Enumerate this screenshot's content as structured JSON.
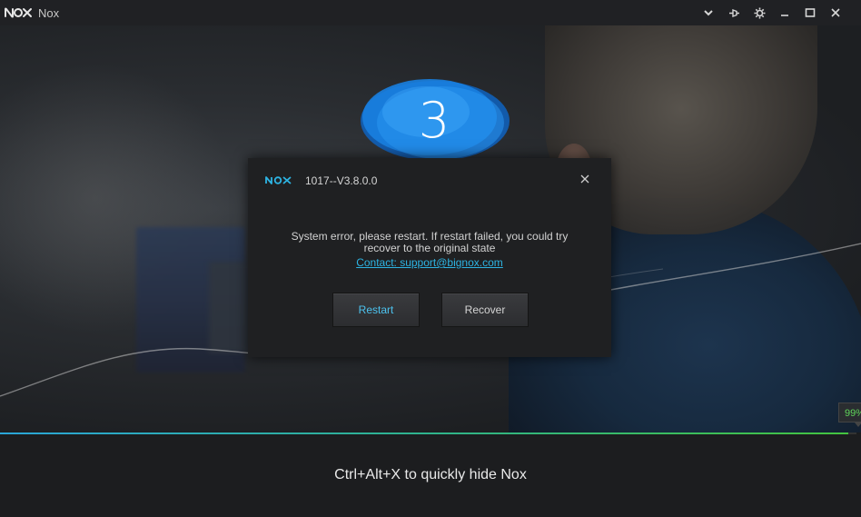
{
  "window": {
    "title": "Nox",
    "logo_icon": "nox-logo-icon",
    "controls": [
      "chevron-down-icon",
      "pin-icon",
      "gear-icon",
      "minimize-icon",
      "maximize-icon",
      "close-icon"
    ]
  },
  "splash": {
    "countdown": "3",
    "progress_percent": 99,
    "progress_label": "99%",
    "tip": "Ctrl+Alt+X to quickly hide Nox"
  },
  "dialog": {
    "title": "1017--V3.8.0.0",
    "message_line1": "System error, please restart. If restart failed, you could try",
    "message_line2": "recover to the original state",
    "contact_link": "Contact: support@bignox.com",
    "restart_label": "Restart",
    "recover_label": "Recover"
  },
  "colors": {
    "accent_blue": "#2db4e3",
    "progress_green": "#44c43f",
    "countdown_blue": "#1a7fe0"
  }
}
